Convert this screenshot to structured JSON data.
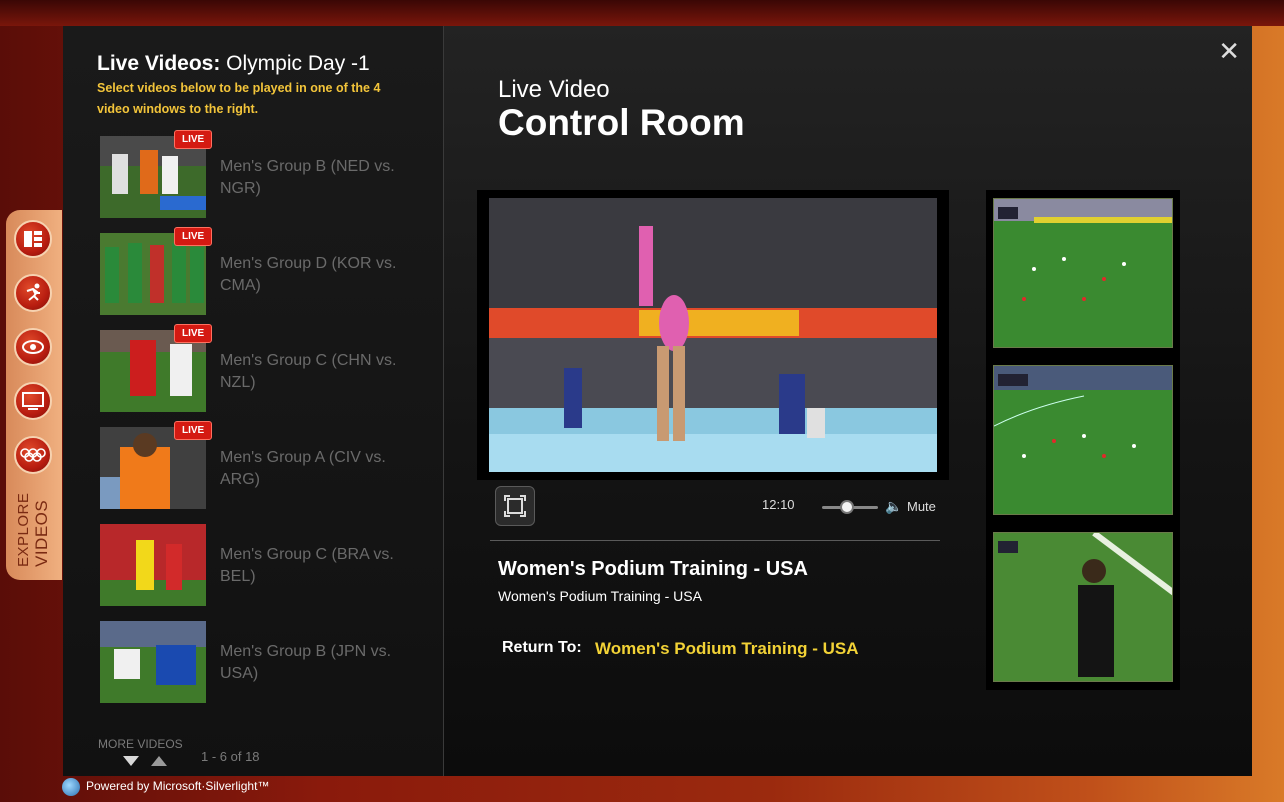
{
  "header": {
    "title_bold": "Live Videos:",
    "title_rest": "Olympic Day -1",
    "subtitle": "Select videos below to be played in one of the 4 video windows to the right."
  },
  "videos": [
    {
      "title": "Men's Group B (NED vs. NGR)",
      "live": "LIVE"
    },
    {
      "title": "Men's Group D (KOR vs. CMA)",
      "live": "LIVE"
    },
    {
      "title": "Men's Group C (CHN vs. NZL)",
      "live": "LIVE"
    },
    {
      "title": "Men's Group A (CIV vs. ARG)",
      "live": "LIVE"
    },
    {
      "title": "Men's Group C (BRA vs. BEL)"
    },
    {
      "title": "Men's Group B (JPN vs. USA)"
    }
  ],
  "pagination": {
    "more_label": "MORE VIDEOS",
    "count": "1 - 6  of  18"
  },
  "sidebar": {
    "label_line1": "EXPLORE",
    "label_line2": "VIDEOS"
  },
  "control_room": {
    "pre_title": "Live Video",
    "title": "Control Room"
  },
  "player": {
    "time": "12:10",
    "mute_label": "Mute",
    "volume_level": 0.45
  },
  "now_playing": {
    "title": "Women's Podium Training - USA",
    "subtitle": "Women's Podium Training - USA"
  },
  "return_to": {
    "label": "Return To:",
    "link": "Women's Podium Training - USA"
  },
  "footer": {
    "powered_by": "Powered by",
    "brand": "Microsoft·Silverlight™"
  },
  "colors": {
    "accent_yellow": "#f2c43a",
    "live_red": "#d41a12",
    "frame_red": "#8a1a0c"
  }
}
